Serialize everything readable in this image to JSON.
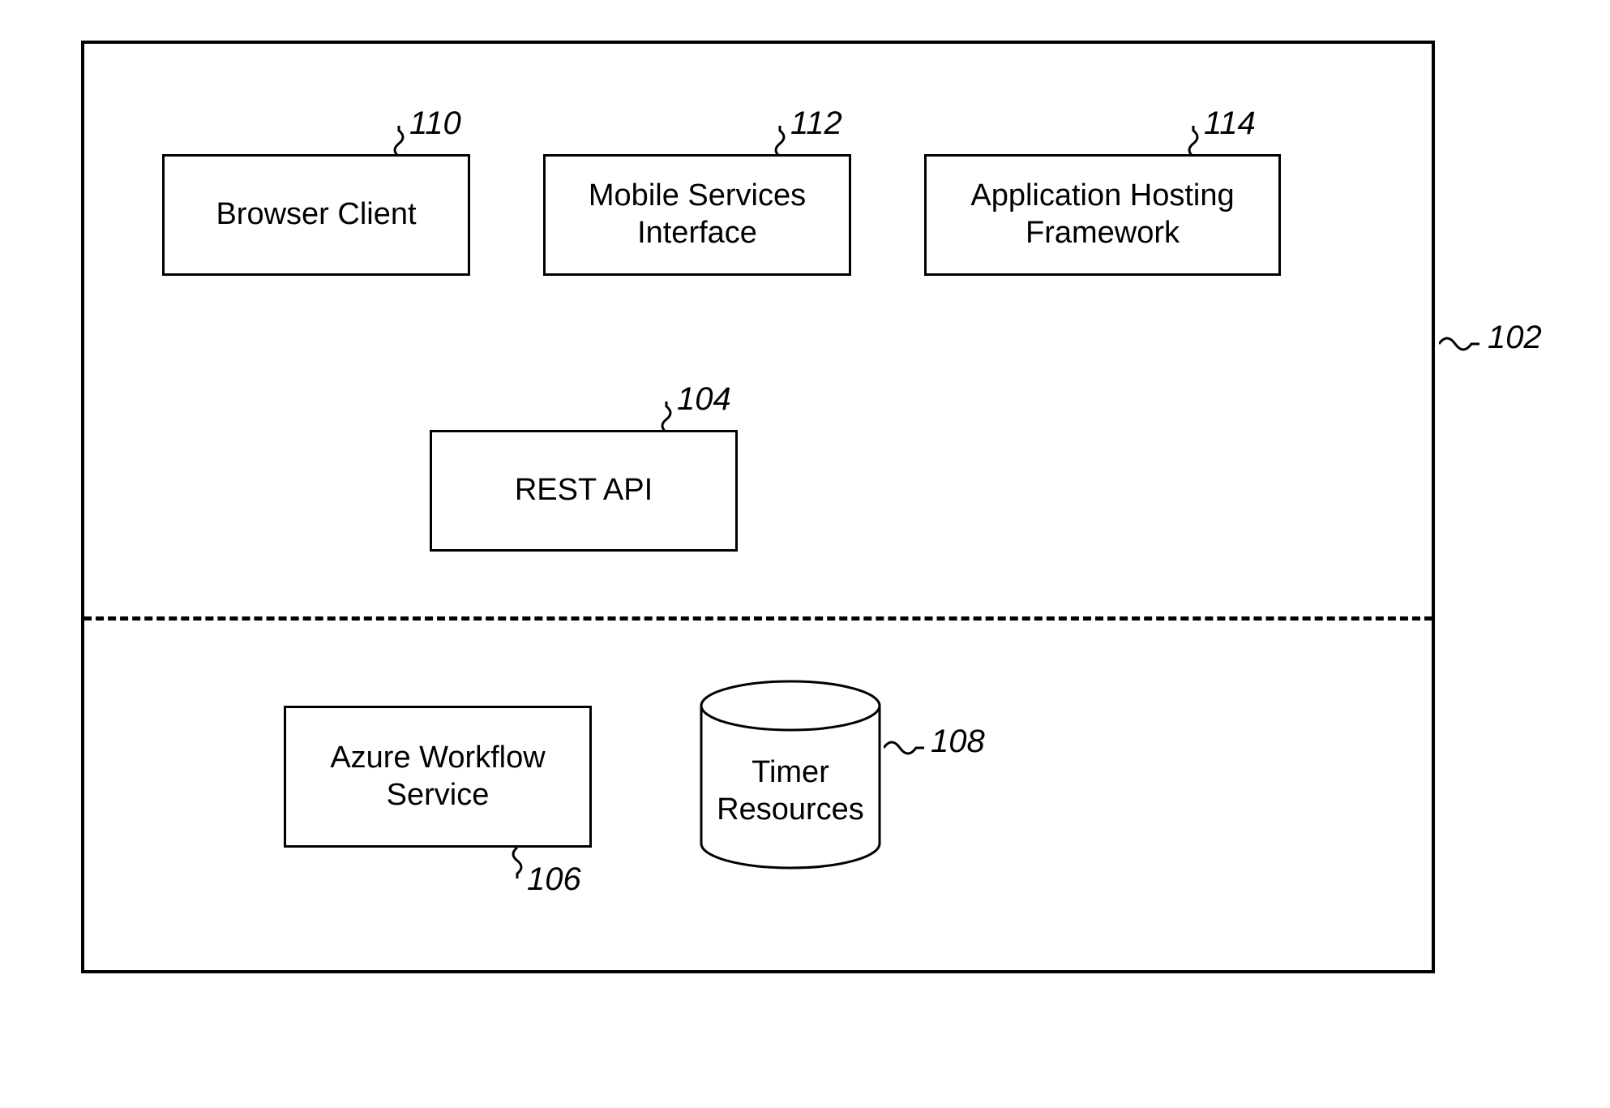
{
  "outer": {
    "ref": "102"
  },
  "blocks": {
    "browser_client": {
      "label": "Browser Client",
      "ref": "110"
    },
    "mobile_services": {
      "label": "Mobile Services\nInterface",
      "ref": "112"
    },
    "app_hosting": {
      "label": "Application Hosting\nFramework",
      "ref": "114"
    },
    "rest_api": {
      "label": "REST API",
      "ref": "104"
    },
    "azure_workflow": {
      "label": "Azure Workflow\nService",
      "ref": "106"
    },
    "timer_resources": {
      "label": "Timer\nResources",
      "ref": "108"
    }
  }
}
